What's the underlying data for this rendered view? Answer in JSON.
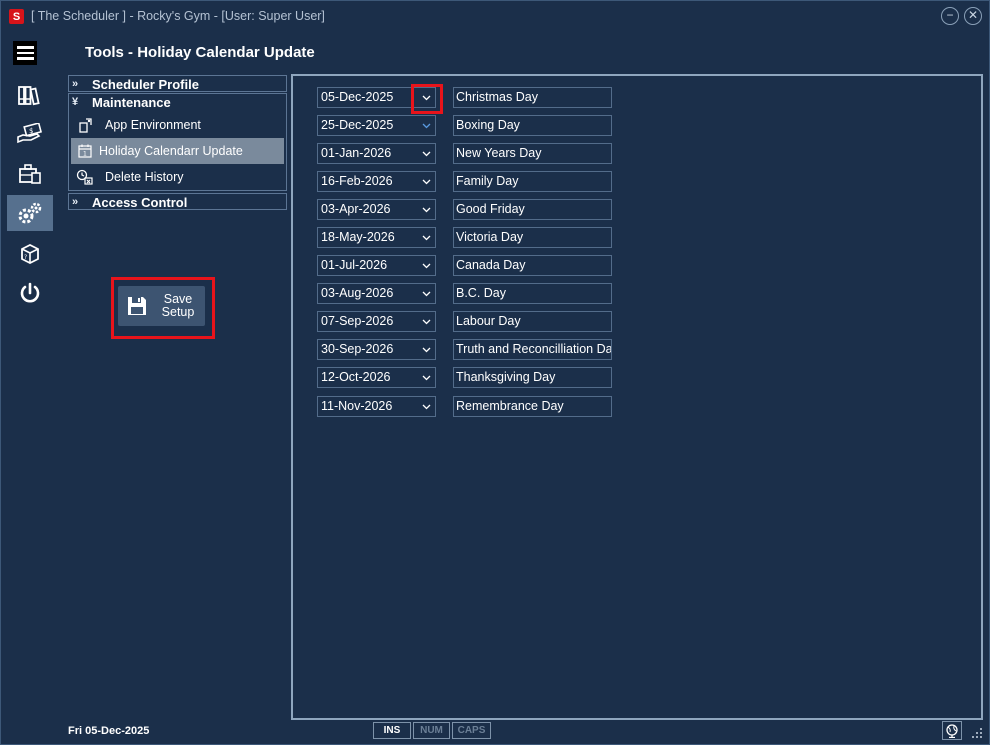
{
  "window": {
    "title": "[ The Scheduler ] - Rocky's Gym - [User: Super User]",
    "minimize_glyph": "−",
    "close_glyph": "✕",
    "logo_letter": "S"
  },
  "rail": {
    "items": [
      {
        "name": "menu-icon"
      },
      {
        "name": "books-icon"
      },
      {
        "name": "money-hand-icon"
      },
      {
        "name": "briefcase-icon"
      },
      {
        "name": "gears-icon",
        "active": true
      },
      {
        "name": "box-icon"
      },
      {
        "name": "power-icon"
      }
    ]
  },
  "page": {
    "title": "Tools -  Holiday Calendar Update"
  },
  "nav": {
    "scheduler_profile": "Scheduler Profile",
    "maintenance": "Maintenance",
    "items": [
      {
        "label": "App Environment"
      },
      {
        "label": "Holiday Calendarr Update",
        "selected": true
      },
      {
        "label": "Delete History"
      }
    ],
    "access_control": "Access Control"
  },
  "save": {
    "line1": "Save",
    "line2": "Setup"
  },
  "holidays": [
    {
      "date": "05-Dec-2025",
      "name": "Christmas Day"
    },
    {
      "date": "25-Dec-2025",
      "name": "Boxing Day"
    },
    {
      "date": "01-Jan-2026",
      "name": "New Years Day"
    },
    {
      "date": "16-Feb-2026",
      "name": "Family Day"
    },
    {
      "date": "03-Apr-2026",
      "name": "Good Friday"
    },
    {
      "date": "18-May-2026",
      "name": "Victoria Day"
    },
    {
      "date": "01-Jul-2026",
      "name": "Canada Day"
    },
    {
      "date": "03-Aug-2026",
      "name": "B.C. Day"
    },
    {
      "date": "07-Sep-2026",
      "name": "Labour Day"
    },
    {
      "date": "30-Sep-2026",
      "name": "Truth and Reconcilliation Day"
    },
    {
      "date": "12-Oct-2026",
      "name": "Thanksgiving Day"
    },
    {
      "date": "11-Nov-2026",
      "name": "Remembrance Day"
    }
  ],
  "status": {
    "date": "Fri  05-Dec-2025",
    "ins": "INS",
    "num": "NUM",
    "caps": "CAPS"
  },
  "colors": {
    "background": "#1b2f4a",
    "highlight": "#e8141b",
    "selected_nav": "#7a8a9c",
    "active_rail": "#56708e"
  }
}
